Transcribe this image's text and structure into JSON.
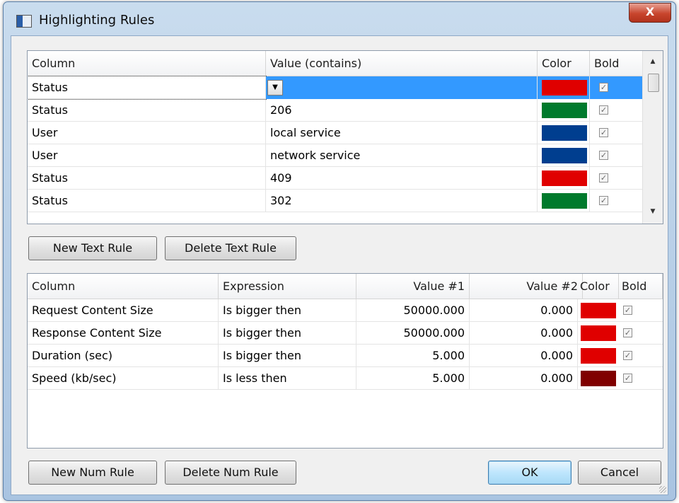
{
  "window": {
    "title": "Highlighting Rules",
    "close_glyph": "X"
  },
  "text_rules": {
    "headers": {
      "column": "Column",
      "value": "Value (contains)",
      "color": "Color",
      "bold": "Bold"
    },
    "rows": [
      {
        "column": "Status",
        "value": "",
        "color": "#e00000",
        "bold": true,
        "selected": true
      },
      {
        "column": "Status",
        "value": "206",
        "color": "#007a2c",
        "bold": true
      },
      {
        "column": "User",
        "value": "local service",
        "color": "#003e8f",
        "bold": true
      },
      {
        "column": "User",
        "value": "network service",
        "color": "#003e8f",
        "bold": true
      },
      {
        "column": "Status",
        "value": "409",
        "color": "#e00000",
        "bold": true
      },
      {
        "column": "Status",
        "value": "302",
        "color": "#007a2c",
        "bold": true
      }
    ]
  },
  "text_buttons": {
    "new": "New Text Rule",
    "delete": "Delete Text Rule"
  },
  "num_rules": {
    "headers": {
      "column": "Column",
      "expression": "Expression",
      "value1": "Value #1",
      "value2": "Value #2",
      "color": "Color",
      "bold": "Bold"
    },
    "rows": [
      {
        "column": "Request Content Size",
        "expression": "Is bigger then",
        "value1": "50000.000",
        "value2": "0.000",
        "color": "#e00000",
        "bold": true
      },
      {
        "column": "Response Content Size",
        "expression": "Is bigger then",
        "value1": "50000.000",
        "value2": "0.000",
        "color": "#e00000",
        "bold": true
      },
      {
        "column": "Duration (sec)",
        "expression": "Is bigger then",
        "value1": "5.000",
        "value2": "0.000",
        "color": "#e00000",
        "bold": true
      },
      {
        "column": "Speed (kb/sec)",
        "expression": "Is less then",
        "value1": "5.000",
        "value2": "0.000",
        "color": "#800000",
        "bold": true
      }
    ]
  },
  "num_buttons": {
    "new": "New Num Rule",
    "delete": "Delete Num Rule"
  },
  "dialog_buttons": {
    "ok": "OK",
    "cancel": "Cancel"
  },
  "icons": {
    "checkbox": "✓",
    "dropdown": "▼",
    "scroll_up": "▲",
    "scroll_down": "▼"
  }
}
